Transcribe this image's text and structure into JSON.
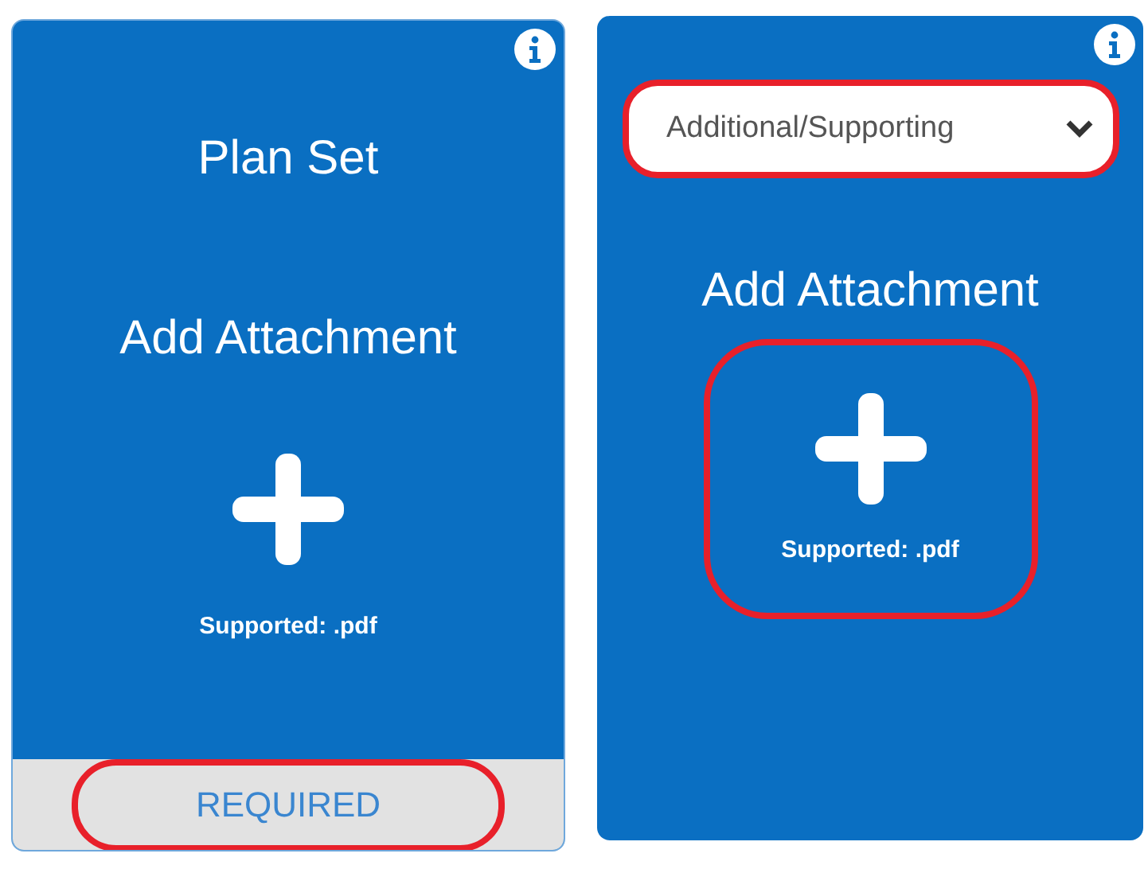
{
  "cards": [
    {
      "kind": "fixed",
      "title": "Plan Set",
      "action": "Add Attachment",
      "add_highlighted": false,
      "supported": "Supported: .pdf",
      "footer": {
        "label": "REQUIRED",
        "highlighted": true
      }
    },
    {
      "kind": "select",
      "select": {
        "value": "Additional/Supporting",
        "highlighted": true
      },
      "action": "Add Attachment",
      "add_highlighted": true,
      "supported": "Supported: .pdf"
    }
  ]
}
